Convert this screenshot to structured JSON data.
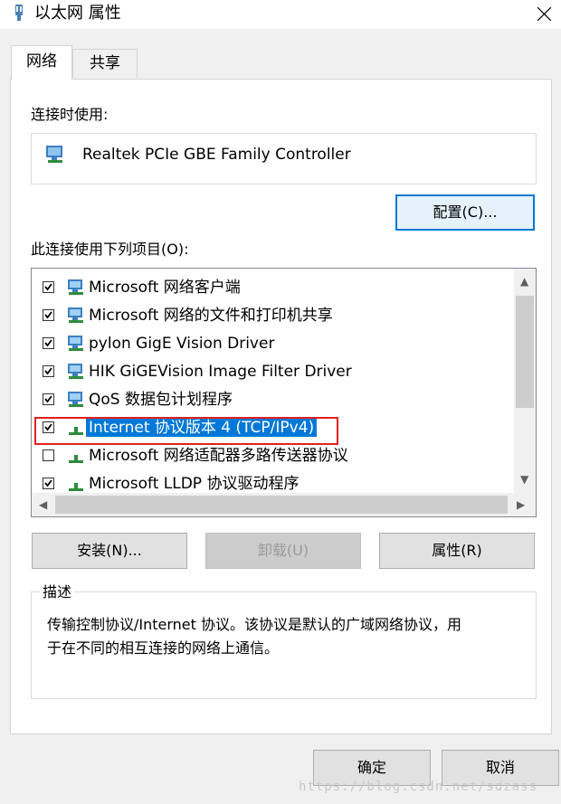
{
  "window": {
    "title": "以太网 属性"
  },
  "tabs": [
    {
      "label": "网络"
    },
    {
      "label": "共享"
    }
  ],
  "connect_using": {
    "label": "连接时使用:",
    "adapter": "Realtek PCIe GBE Family Controller",
    "configure_button": "配置(C)..."
  },
  "items": {
    "label": "此连接使用下列项目(O):",
    "list": [
      {
        "label": "Microsoft 网络客户端",
        "checked": true
      },
      {
        "label": "Microsoft 网络的文件和打印机共享",
        "checked": true
      },
      {
        "label": "pylon GigE Vision Driver",
        "checked": true
      },
      {
        "label": "HIK GiGEVision Image Filter Driver",
        "checked": true
      },
      {
        "label": "QoS 数据包计划程序",
        "checked": true
      },
      {
        "label": "Internet 协议版本 4 (TCP/IPv4)",
        "checked": true,
        "selected": true
      },
      {
        "label": "Microsoft 网络适配器多路传送器协议",
        "checked": false
      },
      {
        "label": "Microsoft LLDP 协议驱动程序",
        "checked": true
      }
    ]
  },
  "buttons": {
    "install": "安装(N)...",
    "uninstall": "卸载(U)",
    "properties": "属性(R)",
    "ok": "确定",
    "cancel": "取消"
  },
  "description": {
    "legend": "描述",
    "text_line1": "传输控制协议/Internet 协议。该协议是默认的广域网络协议，用",
    "text_line2": "于在不同的相互连接的网络上通信。"
  },
  "watermark": "https://blog.csdn.net/sdzass",
  "colors": {
    "accent": "#0078d7",
    "highlight_border": "#e0201e"
  }
}
